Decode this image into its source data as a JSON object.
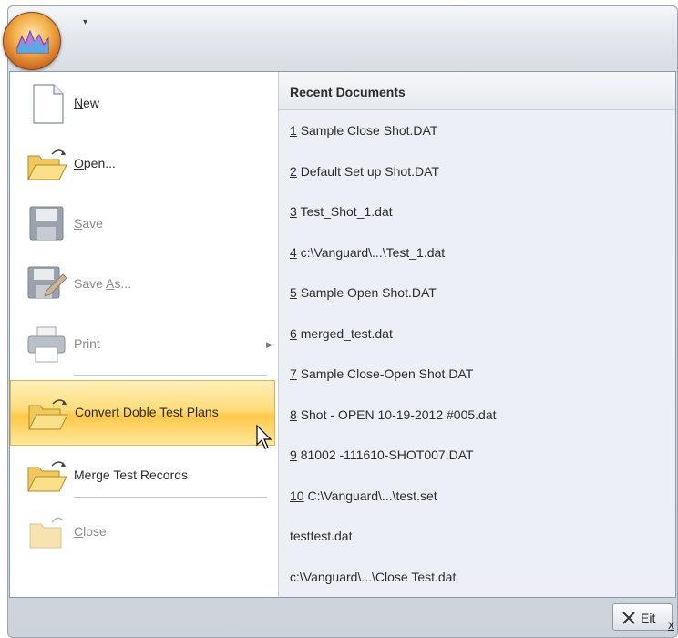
{
  "quick_access": {
    "customize_arrow": "▾"
  },
  "menu_items": [
    {
      "label": "New",
      "mnemonic": "N"
    },
    {
      "label": "Open...",
      "mnemonic": "O"
    },
    {
      "label": "Save",
      "mnemonic": "S",
      "disabled": true
    },
    {
      "label": "Save As...",
      "mnemonic": "A",
      "disabled": true
    },
    {
      "label": "Print",
      "disabled": true,
      "has_submenu": true
    },
    {
      "label": "Convert Doble Test Plans",
      "highlighted": true
    },
    {
      "label": "Merge Test Records"
    },
    {
      "label": "Close",
      "mnemonic": "C",
      "disabled": true
    }
  ],
  "recent": {
    "header": "Recent Documents",
    "items": [
      {
        "num": "1",
        "name": "Sample Close Shot.DAT"
      },
      {
        "num": "2",
        "name": "Default Set up Shot.DAT"
      },
      {
        "num": "3",
        "name": "Test_Shot_1.dat"
      },
      {
        "num": "4",
        "name": "c:\\Vanguard\\...\\Test_1.dat"
      },
      {
        "num": "5",
        "name": "Sample Open Shot.DAT"
      },
      {
        "num": "6",
        "name": "merged_test.dat"
      },
      {
        "num": "7",
        "name": "Sample Close-Open Shot.DAT"
      },
      {
        "num": "8",
        "name": "Shot - OPEN 10-19-2012 #005.dat"
      },
      {
        "num": "9",
        "name": "81002  -111610-SHOT007.DAT"
      },
      {
        "num": "10",
        "name": "C:\\Vanguard\\...\\test.set"
      },
      {
        "num": "",
        "name": "testtest.dat"
      },
      {
        "num": "",
        "name": "c:\\Vanguard\\...\\Close Test.dat"
      }
    ]
  },
  "footer": {
    "exit_label": "Exit",
    "exit_mnemonic": "x"
  },
  "colors": {
    "highlight": "#ffd45e",
    "recent_bg": "#ecf0f6",
    "disabled_text": "#8a8a8a"
  }
}
